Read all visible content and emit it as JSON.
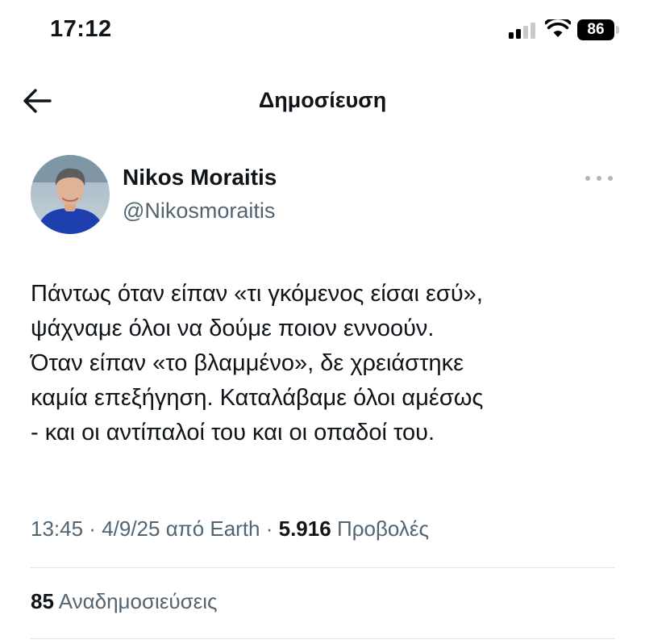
{
  "status_bar": {
    "time": "17:12",
    "battery": "86",
    "icons": [
      "signal-icon",
      "wifi-icon",
      "battery-icon"
    ]
  },
  "nav": {
    "back_icon": "arrow-left-icon",
    "title": "Δημοσίευση"
  },
  "post": {
    "author": {
      "name": "Nikos Moraitis",
      "handle": "@Nikosmoraitis",
      "avatar": "avatar"
    },
    "more_icon": "more-horizontal-icon",
    "text": "Πάντως όταν είπαν «τι γκόμενος είσαι εσύ»,\nψάχναμε όλοι να δούμε ποιον εννοούν.\nΌταν είπαν «το βλαμμένο», δε χρειάστηκε\nκαμία επεξήγηση. Καταλάβαμε όλοι αμέσως\n- και οι αντίπαλοί του και οι οπαδοί του.",
    "meta": {
      "time": "13:45",
      "date": "4/9/25",
      "source": "από Earth",
      "separator": " · ",
      "views_count": "5.916",
      "views_label": "Προβολές"
    },
    "stats": {
      "reposts_count": "85",
      "reposts_label": "Αναδημοσιεύσεις"
    }
  },
  "colors": {
    "text": "#0f1419",
    "secondary": "#536471",
    "divider": "#e1e4e8",
    "more_dots": "#aab8c2",
    "avatar_shirt": "#1e3fae"
  }
}
